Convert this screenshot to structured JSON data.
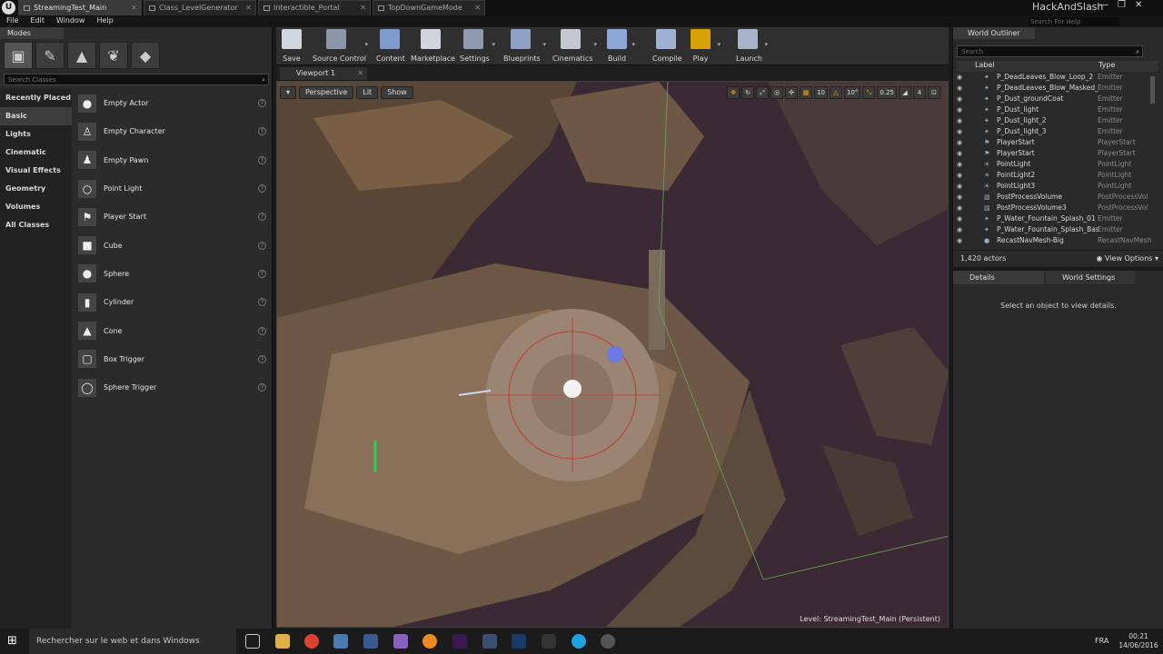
{
  "titlebar": {
    "tabs": [
      {
        "label": "StreamingTest_Main",
        "active": true
      },
      {
        "label": "Class_LevelGenerator",
        "active": false
      },
      {
        "label": "Interactible_Portal",
        "active": false
      },
      {
        "label": "TopDownGameMode",
        "active": false
      }
    ],
    "project_name": "HackAndSlash",
    "search_help_placeholder": "Search For Help"
  },
  "menu": [
    "File",
    "Edit",
    "Window",
    "Help"
  ],
  "modes": {
    "tab_label": "Modes",
    "search_placeholder": "Search Classes",
    "categories": [
      "Recently Placed",
      "Basic",
      "Lights",
      "Cinematic",
      "Visual Effects",
      "Geometry",
      "Volumes",
      "All Classes"
    ],
    "active_category": "Basic",
    "items": [
      "Empty Actor",
      "Empty Character",
      "Empty Pawn",
      "Point Light",
      "Player Start",
      "Cube",
      "Sphere",
      "Cylinder",
      "Cone",
      "Box Trigger",
      "Sphere Trigger"
    ]
  },
  "toolbar": {
    "save": "Save",
    "source_control": "Source Control",
    "content": "Content",
    "marketplace": "Marketplace",
    "settings": "Settings",
    "blueprints": "Blueprints",
    "cinematics": "Cinematics",
    "build": "Build",
    "compile": "Compile",
    "play": "Play",
    "launch": "Launch"
  },
  "viewport": {
    "tab_label": "Viewport 1",
    "perspective": "Perspective",
    "lit": "Lit",
    "show": "Show",
    "grid_snap": "10",
    "rotation_snap": "10°",
    "scale_snap": "0.25",
    "camera_speed": "4",
    "level_prefix": "Level:",
    "level_name": "StreamingTest_Main (Persistent)"
  },
  "outliner": {
    "tab_label": "World Outliner",
    "search_placeholder": "Search",
    "col_label": "Label",
    "col_type": "Type",
    "rows": [
      {
        "name": "P_DeadLeaves_Blow_Loop_2",
        "type": "Emitter"
      },
      {
        "name": "P_DeadLeaves_Blow_Masked_E",
        "type": "Emitter"
      },
      {
        "name": "P_Dust_groundCoat",
        "type": "Emitter"
      },
      {
        "name": "P_Dust_light",
        "type": "Emitter"
      },
      {
        "name": "P_Dust_light_2",
        "type": "Emitter"
      },
      {
        "name": "P_Dust_light_3",
        "type": "Emitter"
      },
      {
        "name": "PlayerStart",
        "type": "PlayerStart"
      },
      {
        "name": "PlayerStart",
        "type": "PlayerStart"
      },
      {
        "name": "PointLight",
        "type": "PointLight"
      },
      {
        "name": "PointLight2",
        "type": "PointLight"
      },
      {
        "name": "PointLight3",
        "type": "PointLight"
      },
      {
        "name": "PostProcessVolume",
        "type": "PostProcessVol"
      },
      {
        "name": "PostProcessVolume3",
        "type": "PostProcessVol"
      },
      {
        "name": "P_Water_Fountain_Splash_01",
        "type": "Emitter"
      },
      {
        "name": "P_Water_Fountain_Splash_Bas",
        "type": "Emitter"
      },
      {
        "name": "RecastNavMesh-Big",
        "type": "RecastNavMesh"
      }
    ],
    "actor_count": "1,420 actors",
    "view_options": "View Options"
  },
  "details": {
    "tab_details": "Details",
    "tab_world_settings": "World Settings",
    "empty_message": "Select an object to view details."
  },
  "taskbar": {
    "search_placeholder": "Rechercher sur le web et dans Windows",
    "language": "FRA",
    "time": "00:21",
    "date": "14/06/2016"
  }
}
